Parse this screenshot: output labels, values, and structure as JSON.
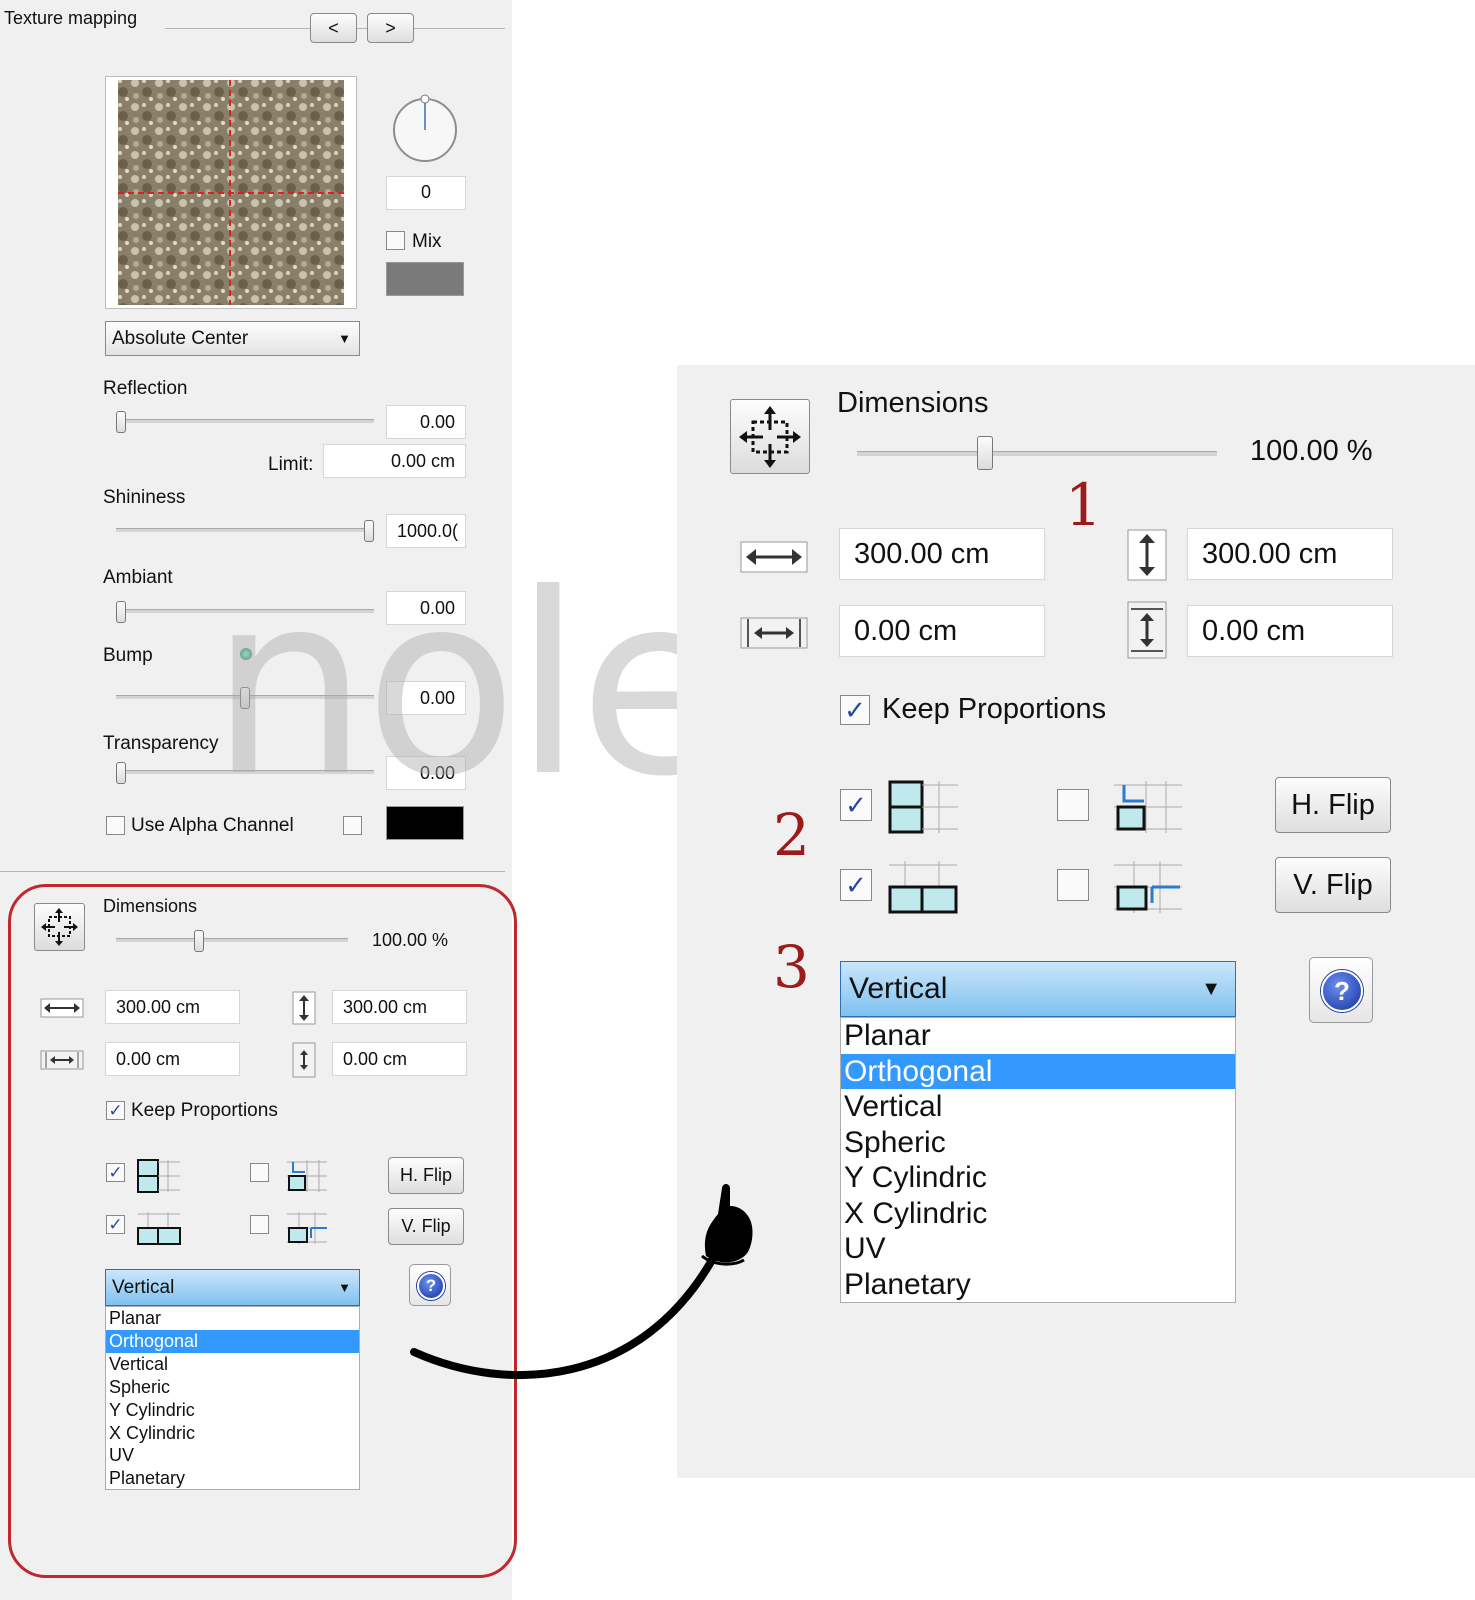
{
  "left": {
    "section_title": "Texture mapping",
    "prev_label": "<",
    "next_label": ">",
    "rotation_value": "0",
    "mix_label": "Mix",
    "mix_checked": false,
    "anchor_select": "Absolute Center",
    "reflection": {
      "label": "Reflection",
      "value": "0.00",
      "level": 0.0
    },
    "limit": {
      "label": "Limit:",
      "value": "0.00 cm"
    },
    "shininess": {
      "label": "Shininess",
      "value": "1000.0(",
      "level": 1.0
    },
    "ambiant": {
      "label": "Ambiant",
      "value": "0.00",
      "level": 0.0
    },
    "bump": {
      "label": "Bump",
      "value": "0.00",
      "level": 0.5
    },
    "transparency": {
      "label": "Transparency",
      "value": "0.00",
      "level": 0.0
    },
    "use_alpha_label": "Use Alpha Channel",
    "dimensions": {
      "label": "Dimensions",
      "percent": "100.00 %",
      "level": 0.35,
      "width": "300.00 cm",
      "height": "300.00 cm",
      "offset_x": "0.00 cm",
      "offset_y": "0.00 cm",
      "keep_label": "Keep Proportions",
      "h_flip": "H. Flip",
      "v_flip": "V. Flip",
      "projection_selected": "Vertical",
      "projection_options": [
        "Planar",
        "Orthogonal",
        "Vertical",
        "Spheric",
        "Y Cylindric",
        "X Cylindric",
        "UV",
        "Planetary"
      ],
      "highlighted_option": "Orthogonal",
      "help_label": "?"
    }
  },
  "zoom": {
    "dimensions_label": "Dimensions",
    "percent": "100.00 %",
    "level": 0.35,
    "width": "300.00 cm",
    "height": "300.00 cm",
    "offset_x": "0.00 cm",
    "offset_y": "0.00 cm",
    "keep_label": "Keep Proportions",
    "h_flip": "H. Flip",
    "v_flip": "V. Flip",
    "projection_selected": "Vertical",
    "projection_options": [
      "Planar",
      "Orthogonal",
      "Vertical",
      "Spheric",
      "Y Cylindric",
      "X Cylindric",
      "UV",
      "Planetary"
    ],
    "highlighted_option": "Orthogonal",
    "help_label": "?",
    "step_numbers": [
      "1",
      "2",
      "3"
    ]
  },
  "watermark": "noletoblog",
  "colors": {
    "frame": "#c0282d",
    "highlight": "#3399ff",
    "step_number": "#9b1b1b"
  }
}
